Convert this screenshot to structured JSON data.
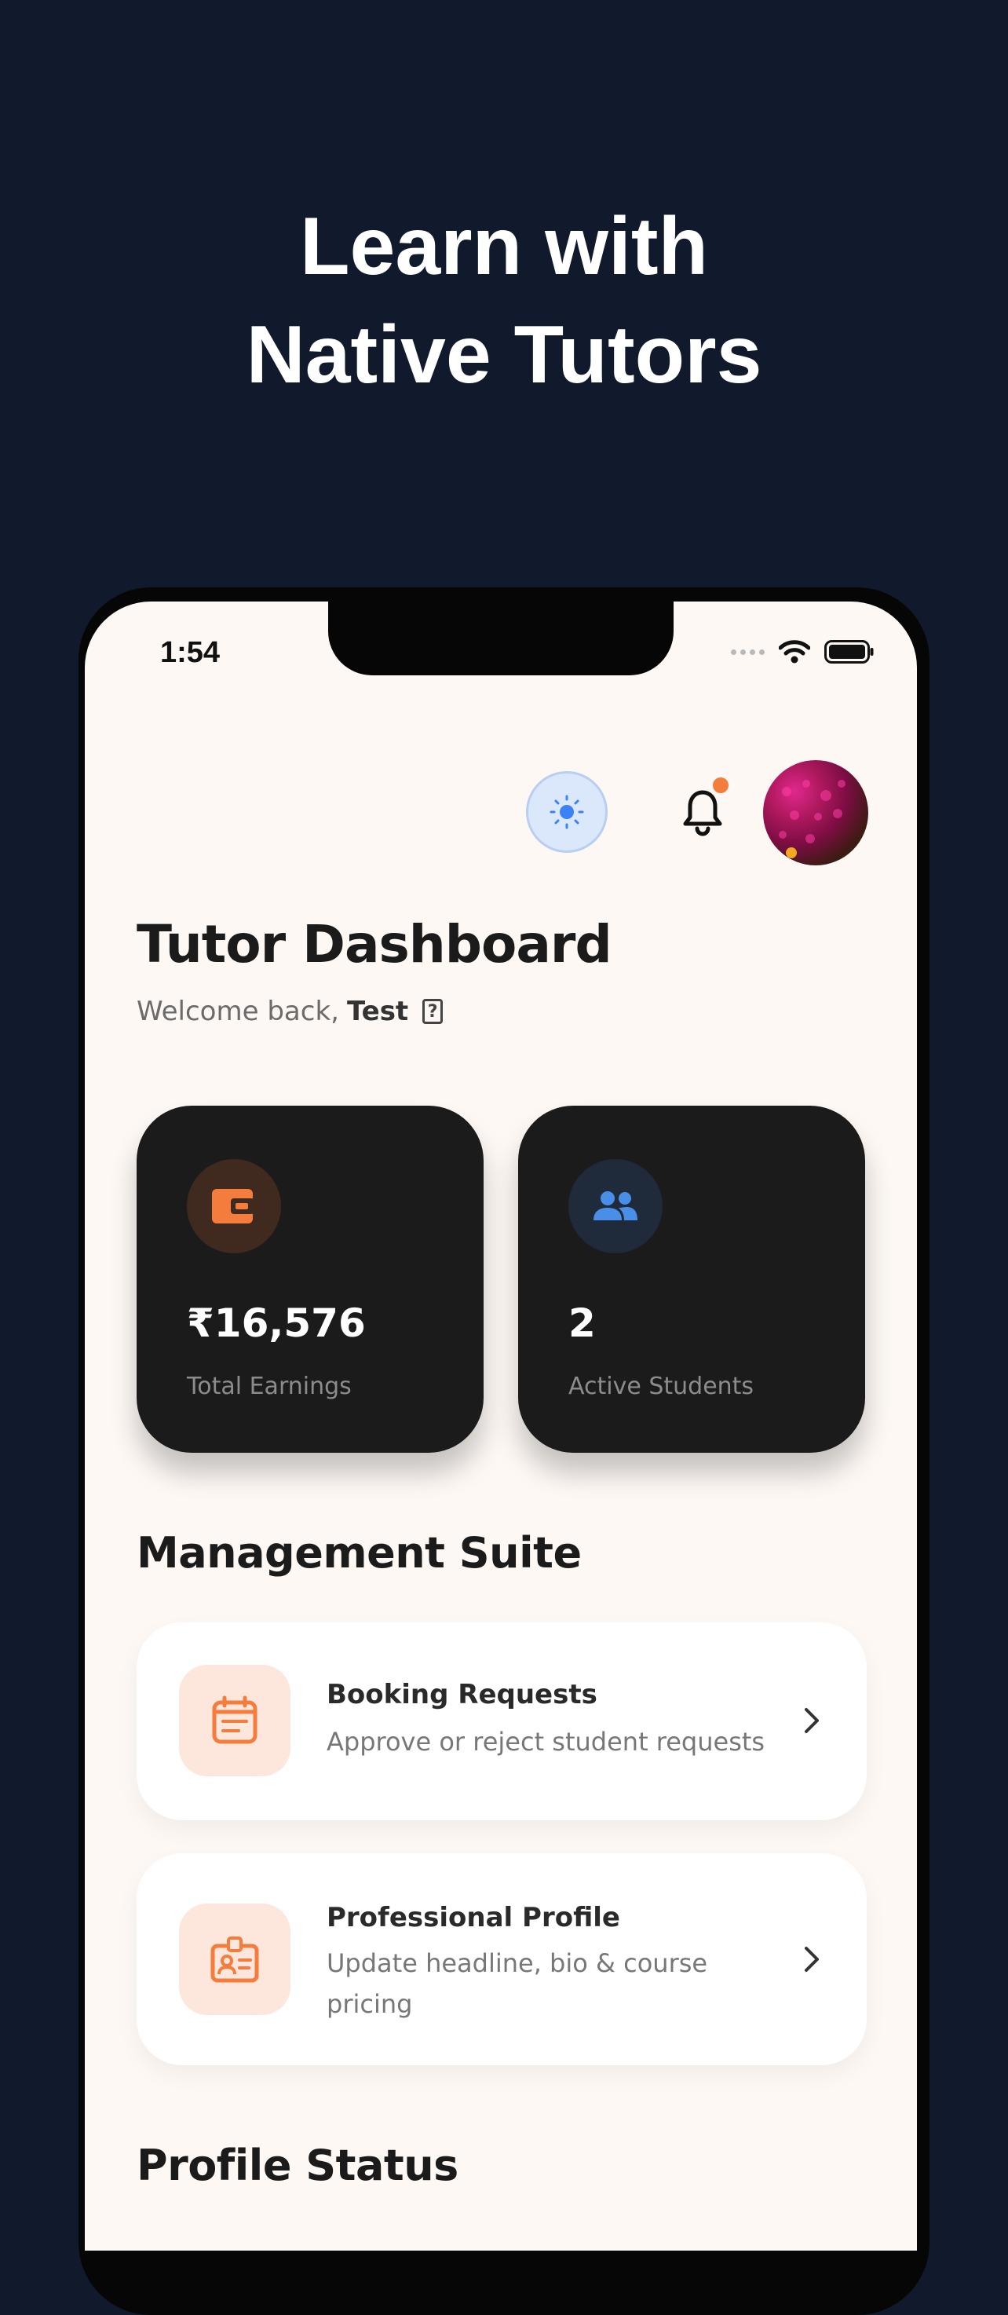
{
  "promo": {
    "headline_line1": "Learn with",
    "headline_line2": "Native Tutors"
  },
  "status_bar": {
    "time": "1:54",
    "icons": [
      "signal-dots-icon",
      "wifi-icon",
      "battery-icon"
    ]
  },
  "header": {
    "theme_toggle_icon": "sun-icon",
    "notification_icon": "bell-icon",
    "has_unread_notifications": true,
    "avatar": "user-avatar"
  },
  "dashboard": {
    "title": "Tutor Dashboard",
    "welcome_prefix": "Welcome back,",
    "user_name": "Test",
    "help_icon_glyph": "?"
  },
  "stats": {
    "earnings": {
      "value": "₹16,576",
      "label": "Total Earnings",
      "icon": "wallet-icon",
      "accent": "#f47c3c"
    },
    "students": {
      "value": "2",
      "label": "Active Students",
      "icon": "people-icon",
      "accent": "#4a8fe7"
    }
  },
  "management": {
    "title": "Management Suite",
    "items": [
      {
        "title": "Booking Requests",
        "description": "Approve or reject student requests",
        "icon": "calendar-icon"
      },
      {
        "title": "Professional Profile",
        "description": "Update headline, bio & course pricing",
        "icon": "id-badge-icon"
      }
    ]
  },
  "profile_status": {
    "title": "Profile Status"
  },
  "colors": {
    "background": "#111a2c",
    "screen": "#fdf8f4",
    "card_dark": "#1b1b1b",
    "accent_orange": "#f47c3c",
    "accent_blue": "#4a8fe7"
  }
}
